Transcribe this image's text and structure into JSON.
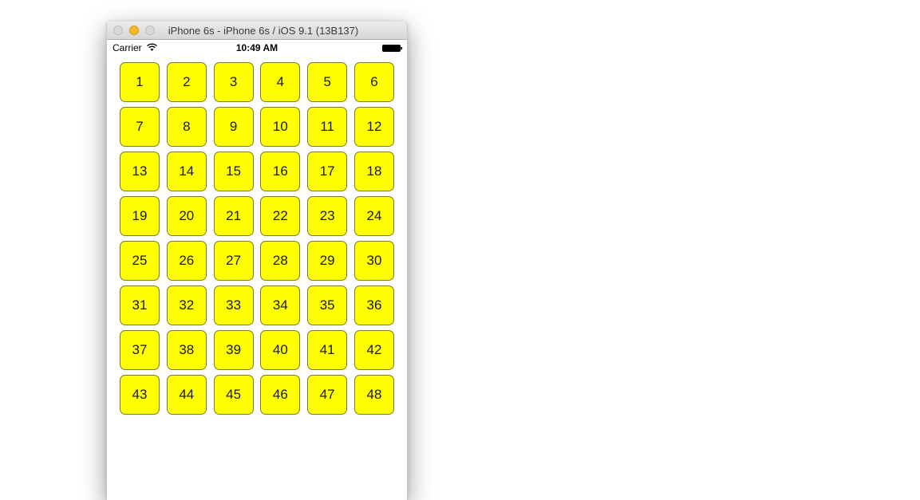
{
  "window": {
    "title": "iPhone 6s - iPhone 6s / iOS 9.1 (13B137)"
  },
  "status_bar": {
    "carrier": "Carrier",
    "time": "10:49 AM"
  },
  "grid": {
    "columns": 6,
    "cell_color": "#ffff00",
    "cells": [
      "1",
      "2",
      "3",
      "4",
      "5",
      "6",
      "7",
      "8",
      "9",
      "10",
      "11",
      "12",
      "13",
      "14",
      "15",
      "16",
      "17",
      "18",
      "19",
      "20",
      "21",
      "22",
      "23",
      "24",
      "25",
      "26",
      "27",
      "28",
      "29",
      "30",
      "31",
      "32",
      "33",
      "34",
      "35",
      "36",
      "37",
      "38",
      "39",
      "40",
      "41",
      "42",
      "43",
      "44",
      "45",
      "46",
      "47",
      "48"
    ]
  }
}
